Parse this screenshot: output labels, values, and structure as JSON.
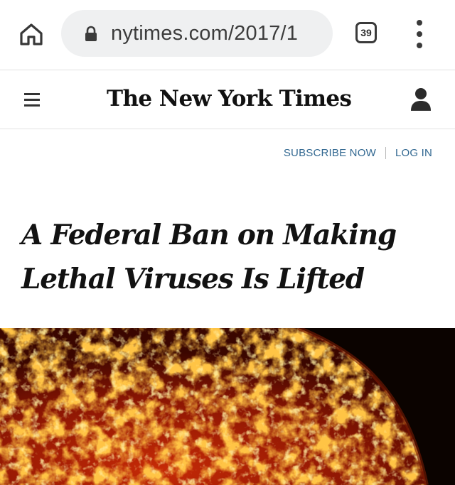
{
  "browser": {
    "url": "nytimes.com/2017/1",
    "tab_count": "39",
    "icons": {
      "home": "home-icon",
      "lock": "lock-icon",
      "tabs": "tab-switcher-icon",
      "menu": "more-vert-icon"
    }
  },
  "masthead": {
    "logo_text": "The New York Times",
    "icons": {
      "menu": "hamburger-icon",
      "account": "user-icon"
    }
  },
  "account_links": {
    "subscribe": "SUBSCRIBE NOW",
    "login": "LOG IN"
  },
  "article": {
    "headline": "A Federal Ban on Making Lethal Viruses Is Lifted",
    "lead_image": "orange-red microscopy image of virus particles on dark background"
  },
  "colors": {
    "link": "#326891",
    "omnibox": "#eff0f1",
    "headline": "#121212",
    "image_hot": "#ff8a10",
    "image_dark": "#0b0300"
  }
}
